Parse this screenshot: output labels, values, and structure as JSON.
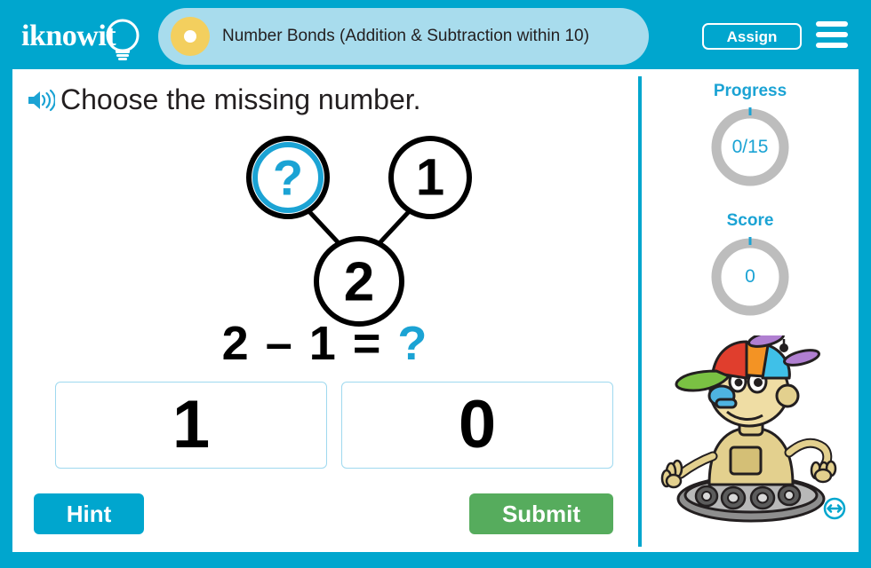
{
  "header": {
    "logo_text": "iknowit",
    "logo_icon": "lightbulb-icon",
    "title": "Number Bonds (Addition & Subtraction within 10)",
    "assign_label": "Assign",
    "menu_icon": "hamburger-menu-icon",
    "bullet_icon": "bullet-dot-icon",
    "bg_color": "#00a6ce",
    "tab_color": "#a8dced",
    "dot_color": "#f3cf5e"
  },
  "question": {
    "audio_icon": "speaker-icon",
    "prompt": "Choose the missing number.",
    "equation": {
      "left": "2",
      "operator": "–",
      "right": "1",
      "equals": "=",
      "unknown": "?"
    },
    "number_bond": {
      "whole": "2",
      "part_known": "1",
      "part_missing": "?",
      "missing_color": "#1ba3d4"
    },
    "choices": [
      {
        "value": "1"
      },
      {
        "value": "0"
      }
    ]
  },
  "actions": {
    "hint_label": "Hint",
    "hint_color": "#00a6ce",
    "submit_label": "Submit",
    "submit_color": "#56ac5d"
  },
  "panel": {
    "progress": {
      "label": "Progress",
      "value": "0/15",
      "completed": 0,
      "total": 15
    },
    "score": {
      "label": "Score",
      "value": "0"
    },
    "accent_color": "#1ba3d4",
    "ring_track_color": "#bdbdbd",
    "mascot_icon": "robot-mascot-propeller-hat",
    "resize_icon": "resize-horizontal-icon"
  }
}
